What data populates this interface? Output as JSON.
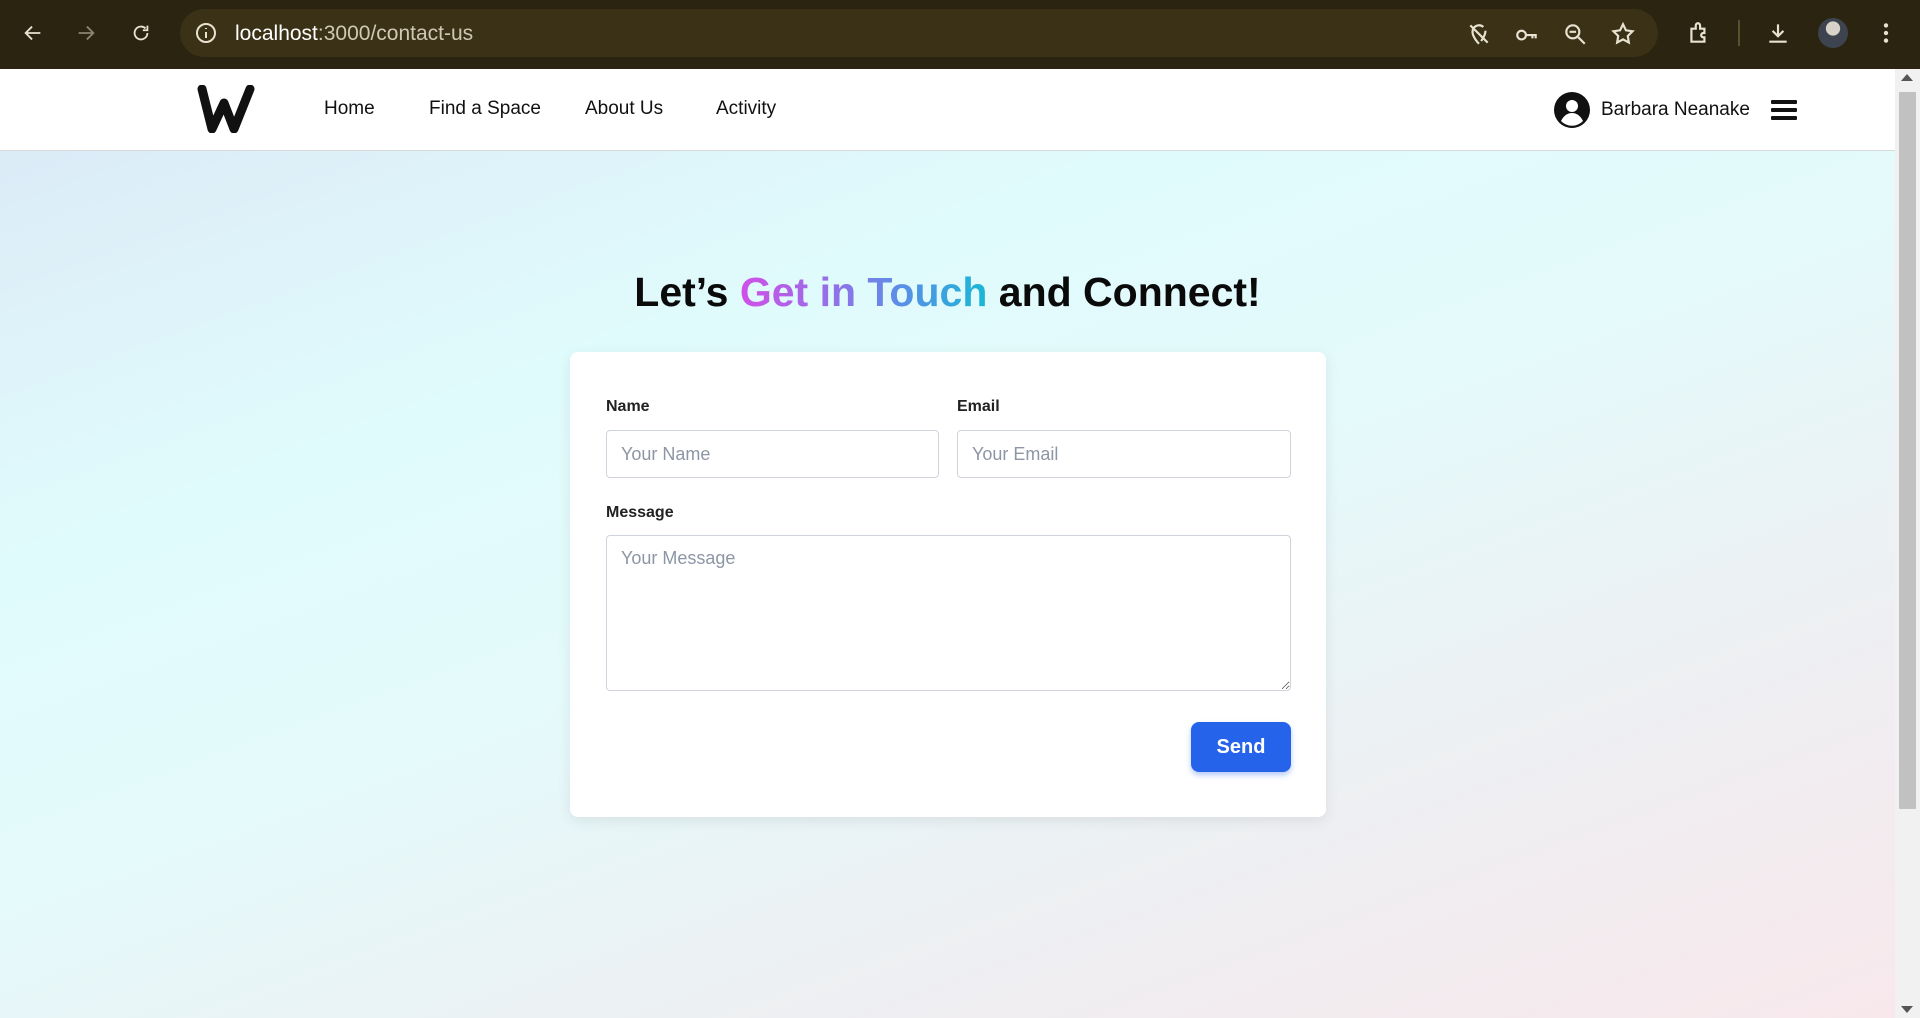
{
  "browser": {
    "url_host": "localhost",
    "url_path": ":3000/contact-us",
    "icons": [
      "back-icon",
      "forward-icon",
      "reload-icon",
      "site-info-icon",
      "location-off-icon",
      "key-icon",
      "zoom-icon",
      "bookmark-star-icon",
      "extensions-icon",
      "download-icon",
      "profile-avatar",
      "kebab-menu-icon"
    ]
  },
  "header": {
    "nav": {
      "home": "Home",
      "find_space": "Find a Space",
      "about": "About Us",
      "activity": "Activity"
    },
    "user_name": "Barbara Neanake"
  },
  "hero": {
    "title_before": "Let’s ",
    "title_highlight": "Get in Touch",
    "title_after": " and Connect!"
  },
  "form": {
    "name_label": "Name",
    "name_placeholder": "Your Name",
    "email_label": "Email",
    "email_placeholder": "Your Email",
    "message_label": "Message",
    "message_placeholder": "Your Message",
    "send_label": "Send"
  },
  "colors": {
    "accent": "#2563eb",
    "gradient": [
      "#d14fe8",
      "#5b8ee6",
      "#19b7d6"
    ],
    "chrome": "#2b2410"
  }
}
